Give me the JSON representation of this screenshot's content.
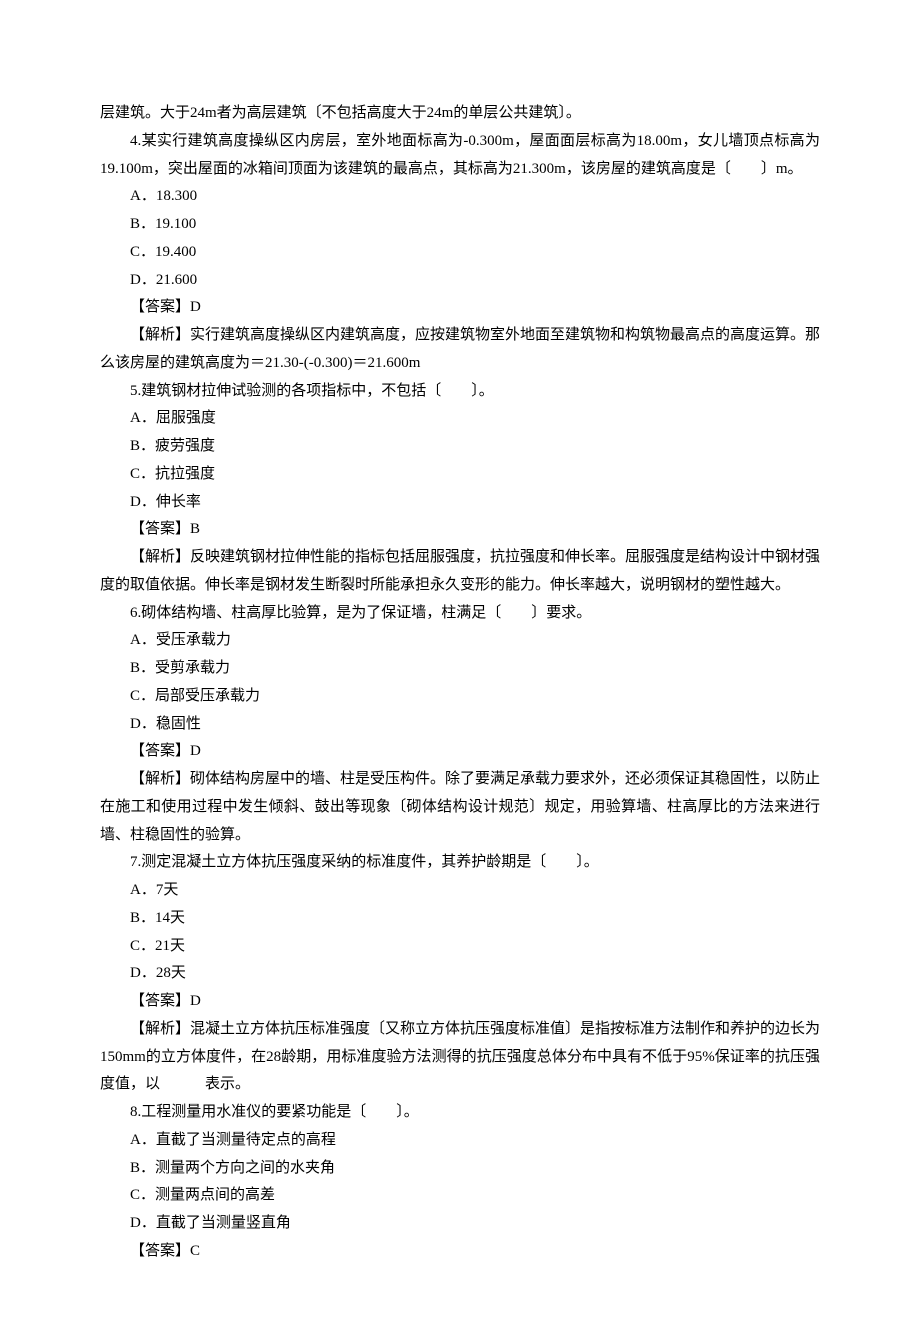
{
  "intro": {
    "line1": "层建筑。大于24m者为高层建筑〔不包括高度大于24m的单层公共建筑〕。"
  },
  "q4": {
    "stem": "4.某实行建筑高度操纵区内房层，室外地面标高为-0.300m，屋面面层标高为18.00m，女儿墙顶点标高为19.100m，突出屋面的冰箱间顶面为该建筑的最高点，其标高为21.300m，该房屋的建筑高度是〔　　〕m。",
    "A": "A．18.300",
    "B": "B．19.100",
    "C": "C．19.400",
    "D": "D．21.600",
    "ans": "【答案】D",
    "exp": "【解析】实行建筑高度操纵区内建筑高度，应按建筑物室外地面至建筑物和构筑物最高点的高度运算。那么该房屋的建筑高度为＝21.30-(-0.300)＝21.600m"
  },
  "q5": {
    "stem": "5.建筑钢材拉伸试验测的各项指标中，不包括〔　　〕。",
    "A": "A．屈服强度",
    "B": "B．疲劳强度",
    "C": "C．抗拉强度",
    "D": "D．伸长率",
    "ans": "【答案】B",
    "exp": "【解析】反映建筑钢材拉伸性能的指标包括屈服强度，抗拉强度和伸长率。屈服强度是结构设计中钢材强度的取值依据。伸长率是钢材发生断裂时所能承担永久变形的能力。伸长率越大，说明钢材的塑性越大。"
  },
  "q6": {
    "stem": "6.砌体结构墙、柱高厚比验算，是为了保证墙，柱满足〔　　〕要求。",
    "A": "A．受压承载力",
    "B": "B．受剪承载力",
    "C": "C．局部受压承载力",
    "D": "D．稳固性",
    "ans": "【答案】D",
    "exp": "【解析】砌体结构房屋中的墙、柱是受压构件。除了要满足承载力要求外，还必须保证其稳固性，以防止在施工和使用过程中发生倾斜、鼓出等现象〔砌体结构设计规范〕规定，用验算墙、柱高厚比的方法来进行墙、柱稳固性的验算。"
  },
  "q7": {
    "stem": "7.测定混凝土立方体抗压强度采纳的标准度件，其养护龄期是〔　　〕。",
    "A": "A．7天",
    "B": "B．14天",
    "C": "C．21天",
    "D": "D．28天",
    "ans": "【答案】D",
    "exp": "【解析】混凝土立方体抗压标准强度〔又称立方体抗压强度标准值〕是指按标准方法制作和养护的边长为150mm的立方体度件，在28龄期，用标准度验方法测得的抗压强度总体分布中具有不低于95%保证率的抗压强度值，以　　　表示。"
  },
  "q8": {
    "stem": "8.工程测量用水准仪的要紧功能是〔　　〕。",
    "A": "A．直截了当测量待定点的高程",
    "B": "B．测量两个方向之间的水夹角",
    "C": "C．测量两点间的高差",
    "D": "D．直截了当测量竖直角",
    "ans": "【答案】C"
  }
}
